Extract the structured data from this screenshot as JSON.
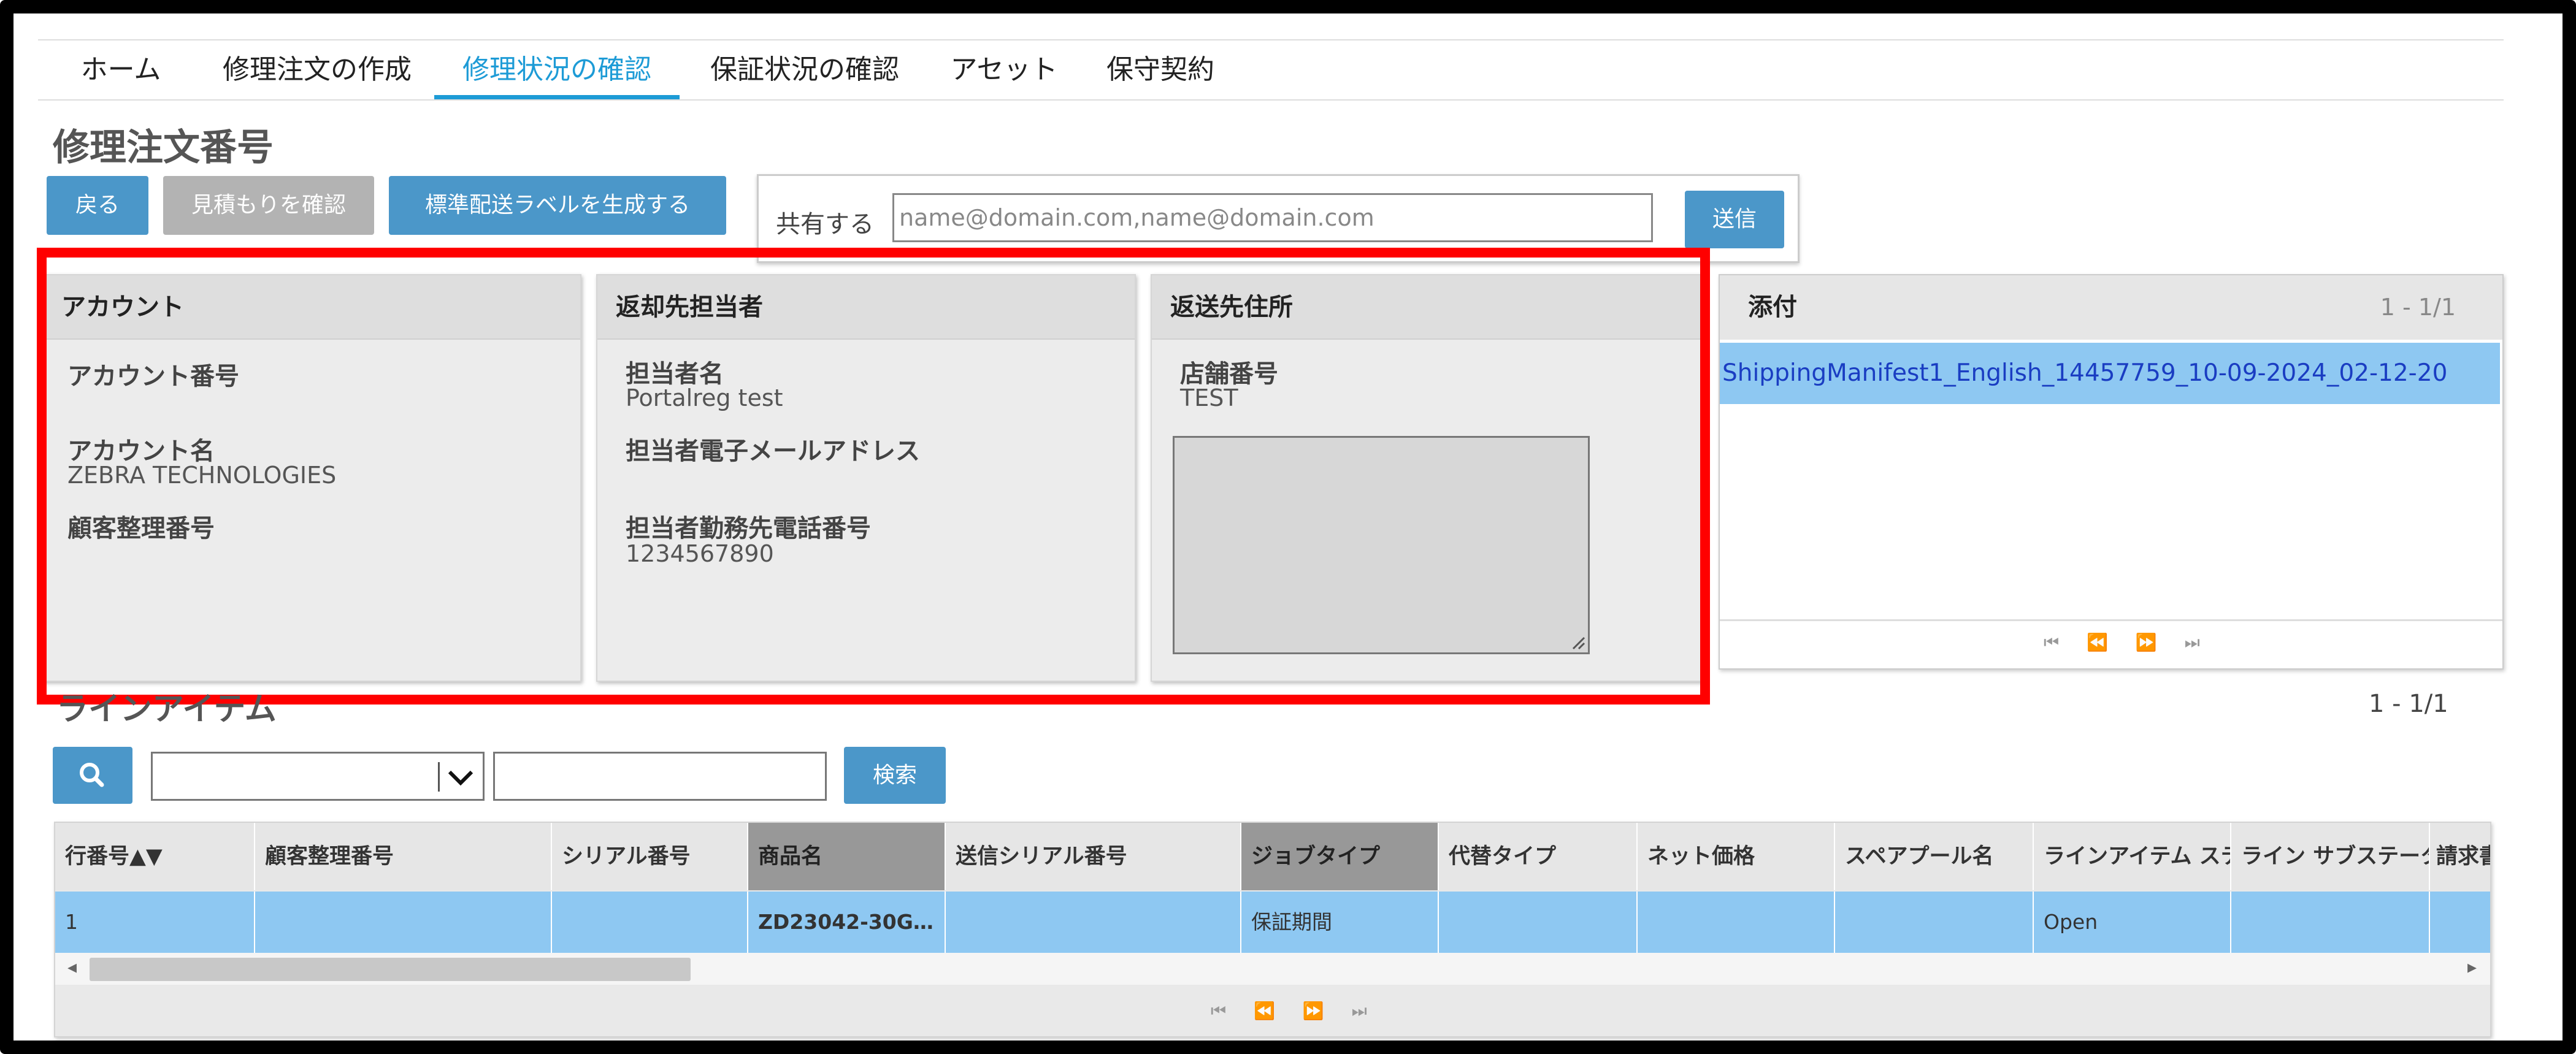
{
  "nav": {
    "items": [
      {
        "label": "ホーム"
      },
      {
        "label": "修理注文の作成"
      },
      {
        "label": "修理状況の確認"
      },
      {
        "label": "保証状況の確認"
      },
      {
        "label": "アセット"
      },
      {
        "label": "保守契約"
      }
    ],
    "active_item": "修理状況の確認"
  },
  "page_title": "修理注文番号",
  "actions": {
    "back": "戻る",
    "view_estimate": "見積もりを確認",
    "generate_label": "標準配送ラベルを生成する"
  },
  "share": {
    "label": "共有する",
    "placeholder": "name@domain.com,name@domain.com",
    "send": "送信"
  },
  "account_panel": {
    "title": "アカウント",
    "account_number_label": "アカウント番号",
    "account_name_label": "アカウント名",
    "account_name_value": "ZEBRA TECHNOLOGIES",
    "customer_ref_label": "顧客整理番号"
  },
  "contact_panel": {
    "title": "返却先担当者",
    "name_label": "担当者名",
    "name_value": "Portalreg test",
    "email_label": "担当者電子メールアドレス",
    "phone_label": "担当者勤務先電話番号",
    "phone_value": "1234567890"
  },
  "address_panel": {
    "title": "返送先住所",
    "store_label": "店舗番号",
    "store_value": "TEST"
  },
  "attachments": {
    "title": "添付",
    "range": "1 - 1/1",
    "files": [
      "ShippingManifest1_English_14457759_10-09-2024_02-12-20"
    ],
    "pager": "⏮ ⏪ ⏩ ⏭"
  },
  "line_items": {
    "title": "ラインアイテム",
    "range": "1 - 1/1",
    "search_button": "検索",
    "columns": [
      "行番号▲▼",
      "顧客整理番号",
      "シリアル番号",
      "商品名",
      "送信シリアル番号",
      "ジョブタイプ",
      "代替タイプ",
      "ネット価格",
      "スペアプール名",
      "ラインアイテム ステ",
      "ライン サブステータ",
      "請求書"
    ],
    "rows": [
      [
        "1",
        "",
        "",
        "ZD23042-30G…",
        "",
        "保証期間",
        "",
        "",
        "",
        "Open",
        "",
        ""
      ]
    ],
    "pager": "⏮ ⏪ ⏩ ⏭"
  },
  "colors": {
    "accent": "#1d9bd6",
    "button_blue": "#4b97c9",
    "button_gray": "#b3b3b3",
    "selected_row": "#8ec8f2",
    "highlight": "#ff0000"
  }
}
